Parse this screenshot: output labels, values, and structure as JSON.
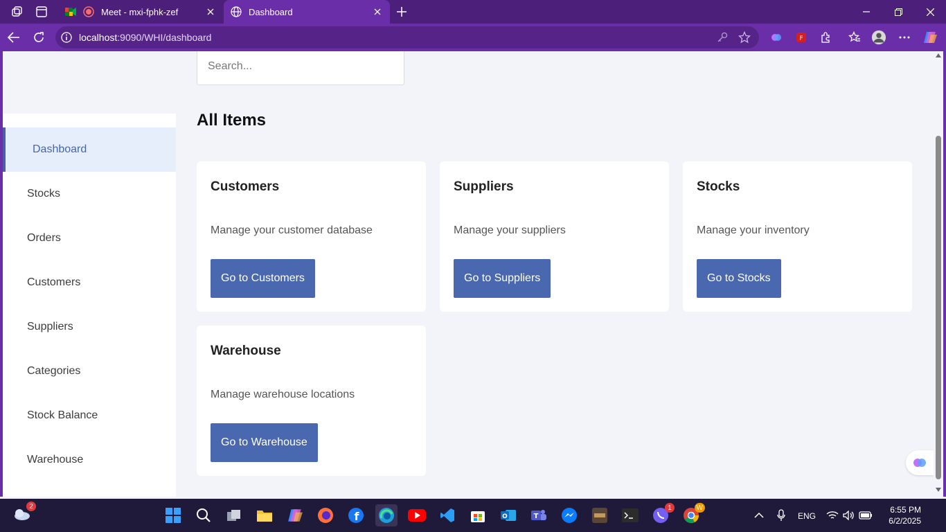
{
  "browser": {
    "tabs": [
      {
        "title": "Meet - mxi-fphk-zef",
        "active": false
      },
      {
        "title": "Dashboard",
        "active": true
      }
    ],
    "url_host": "localhost",
    "url_rest": ":9090/WHI/dashboard"
  },
  "search": {
    "placeholder": "Search..."
  },
  "sidebar": {
    "items": [
      {
        "label": "Dashboard",
        "active": true
      },
      {
        "label": "Stocks"
      },
      {
        "label": "Orders"
      },
      {
        "label": "Customers"
      },
      {
        "label": "Suppliers"
      },
      {
        "label": "Categories"
      },
      {
        "label": "Stock Balance"
      },
      {
        "label": "Warehouse"
      }
    ]
  },
  "main": {
    "heading": "All Items",
    "cards": [
      {
        "title": "Customers",
        "description": "Manage your customer database",
        "button": "Go to Customers"
      },
      {
        "title": "Suppliers",
        "description": "Manage your suppliers",
        "button": "Go to Suppliers"
      },
      {
        "title": "Stocks",
        "description": "Manage your inventory",
        "button": "Go to Stocks"
      },
      {
        "title": "Warehouse",
        "description": "Manage warehouse locations",
        "button": "Go to Warehouse"
      }
    ]
  },
  "taskbar": {
    "weather_badge": "2",
    "viber_badge": "1",
    "chrome_badge": "W",
    "language": "ENG",
    "time": "6:55 PM",
    "date": "6/2/2025"
  },
  "colors": {
    "titlebar": "#4b1f7a",
    "toolbar": "#6a2fa8",
    "accent_button": "#4a68b0",
    "sidebar_active_bg": "#e6eefc",
    "sidebar_active_text": "#4466aa",
    "page_bg": "#f3f4f9"
  }
}
